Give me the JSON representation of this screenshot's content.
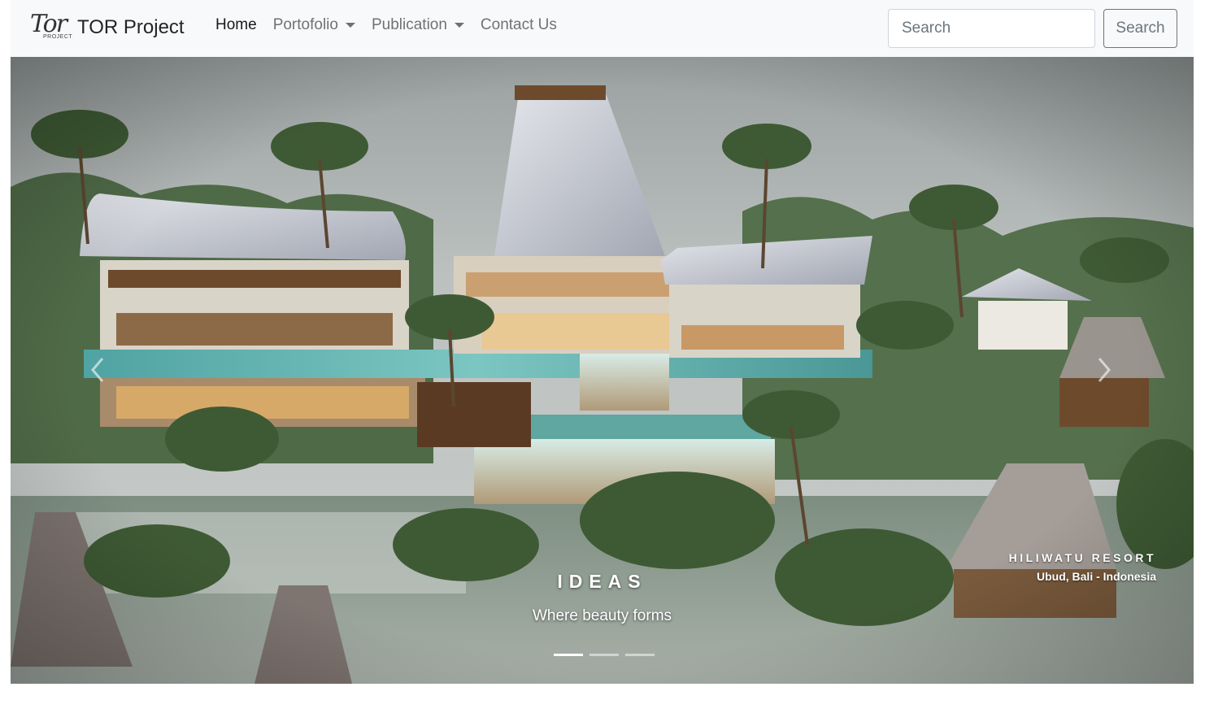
{
  "navbar": {
    "logo_script": "Tor",
    "logo_sub": "PROJECT",
    "brand_text": "TOR Project",
    "links": [
      {
        "label": "Home",
        "active": true,
        "dropdown": false
      },
      {
        "label": "Portofolio",
        "active": false,
        "dropdown": true
      },
      {
        "label": "Publication",
        "active": false,
        "dropdown": true
      },
      {
        "label": "Contact Us",
        "active": false,
        "dropdown": false
      }
    ],
    "search_placeholder": "Search",
    "search_button": "Search"
  },
  "carousel": {
    "caption_title": "IDEAS",
    "caption_subtitle": "Where beauty forms",
    "image_title": "HILIWATU RESORT",
    "image_location": "Ubud, Bali - Indonesia",
    "slides_count": 3,
    "active_slide": 1,
    "prev_icon": "chevron-left-icon",
    "next_icon": "chevron-right-icon"
  },
  "colors": {
    "navbar_bg": "#f8f9fa",
    "link_active": "#212529",
    "link_muted": "#6c757d"
  }
}
